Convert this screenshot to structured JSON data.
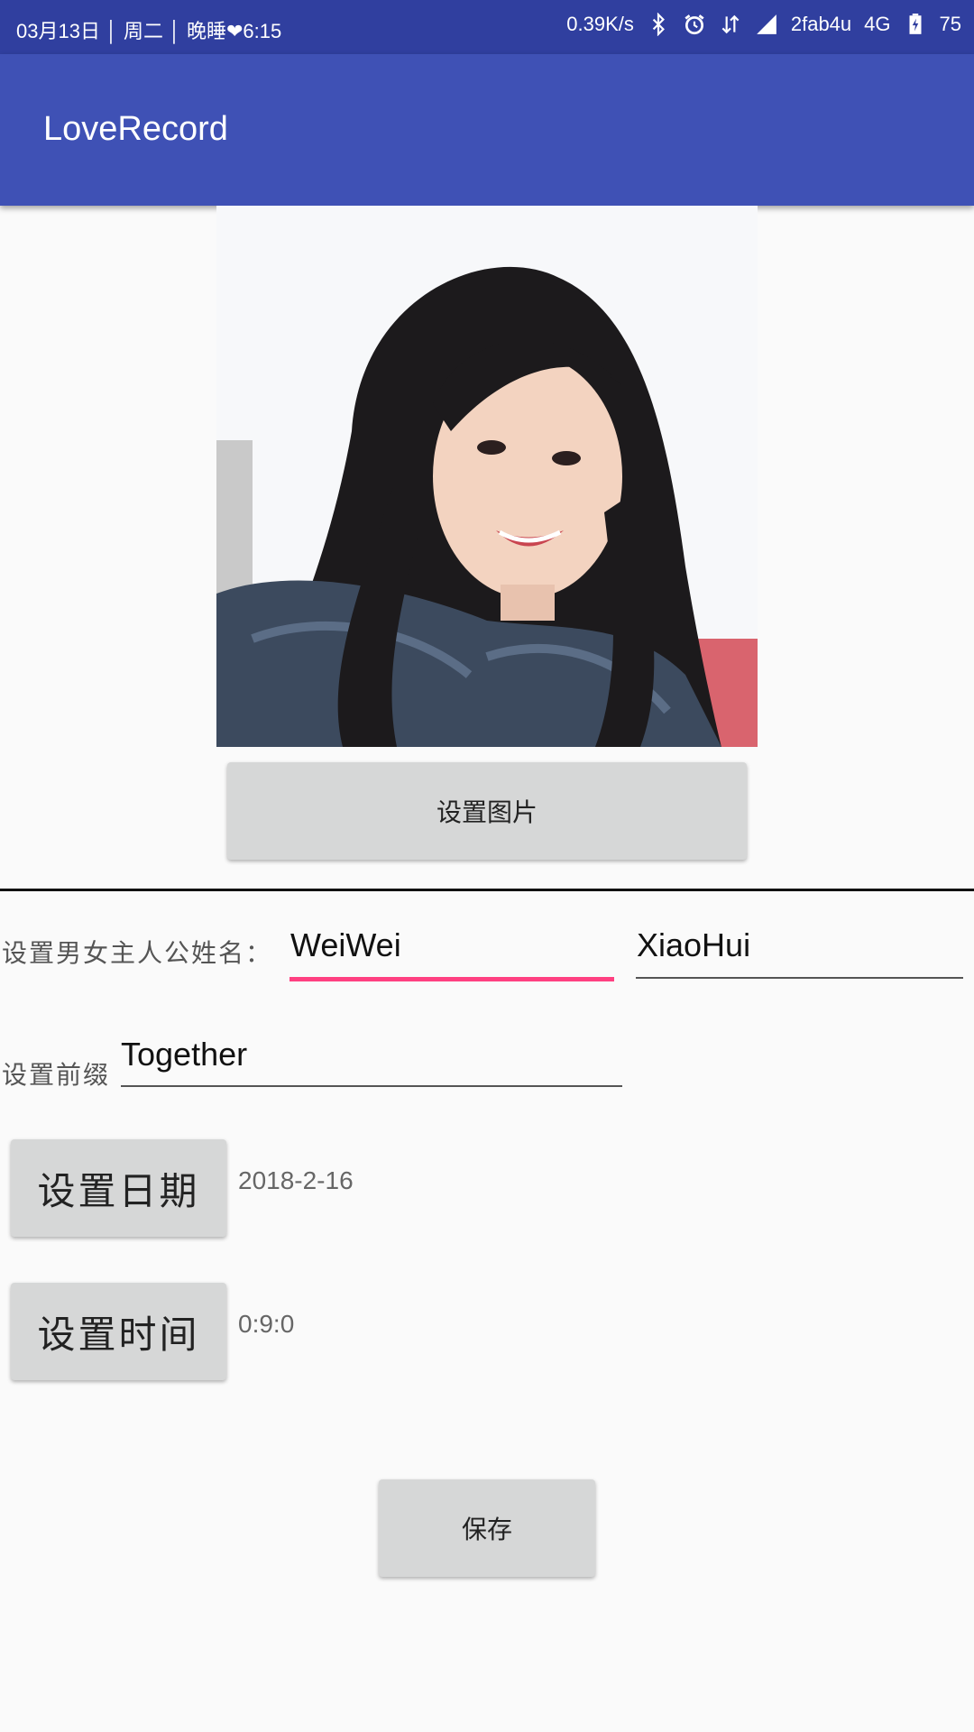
{
  "status_bar": {
    "date": "03月13日",
    "weekday": "周二",
    "note": "晚睡❤6:15",
    "speed": "0.39K/s",
    "carrier": "2fab4u",
    "network": "4G",
    "battery": "75",
    "icons": [
      "bluetooth-icon",
      "alarm-icon",
      "data-transfer-icon",
      "signal-icon",
      "battery-charging-icon"
    ]
  },
  "app_bar": {
    "title": "LoveRecord"
  },
  "image_section": {
    "set_image_label": "设置图片"
  },
  "names": {
    "label": "设置男女主人公姓名：",
    "name1": "WeiWei",
    "name2": "XiaoHui"
  },
  "prefix": {
    "label": "设置前缀",
    "value": "Together"
  },
  "date": {
    "button_label": "设置日期",
    "value": "2018-2-16"
  },
  "time": {
    "button_label": "设置时间",
    "value": "0:9:0"
  },
  "save": {
    "label": "保存"
  },
  "colors": {
    "status_bar": "#303f9f",
    "app_bar": "#3f51b5",
    "accent": "#ff4081",
    "button": "#d6d7d7"
  }
}
